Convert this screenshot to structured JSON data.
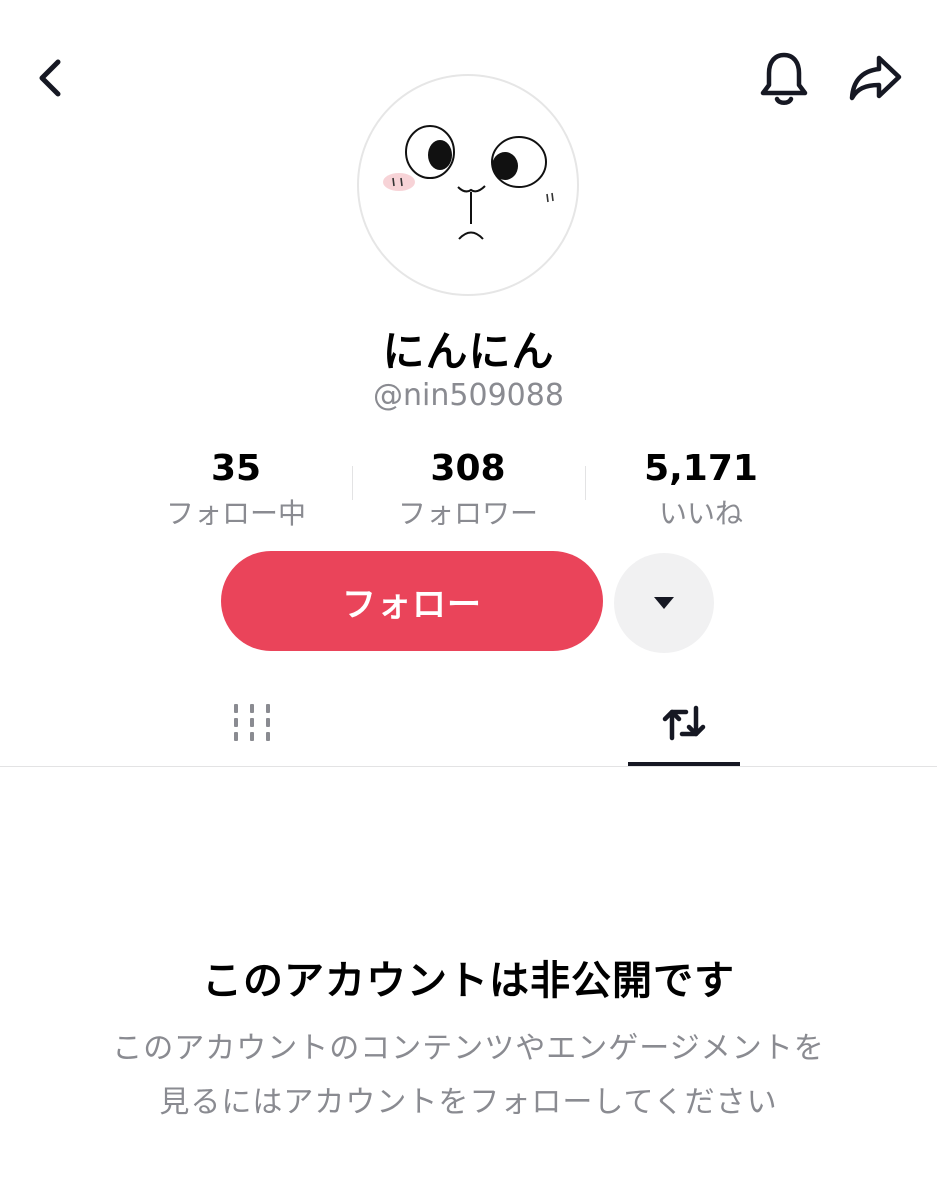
{
  "header": {
    "back_icon": "chevron-left-icon",
    "bell_icon": "bell-icon",
    "share_icon": "share-arrow-icon"
  },
  "profile": {
    "display_name": "にんにん",
    "username": "@nin509088",
    "avatar": "cartoon-face-avatar"
  },
  "stats": [
    {
      "value": "35",
      "label": "フォロー中"
    },
    {
      "value": "308",
      "label": "フォロワー"
    },
    {
      "value": "5,171",
      "label": "いいね"
    }
  ],
  "actions": {
    "follow_label": "フォロー",
    "more_icon": "caret-down-icon",
    "follow_color": "#ea445a"
  },
  "tabs": [
    {
      "icon": "grid-icon",
      "selected": false
    },
    {
      "icon": "repost-icon",
      "selected": true
    }
  ],
  "private_notice": {
    "title": "このアカウントは非公開です",
    "description_line1": "このアカウントのコンテンツやエンゲージメントを",
    "description_line2": "見るにはアカウントをフォローしてください"
  }
}
